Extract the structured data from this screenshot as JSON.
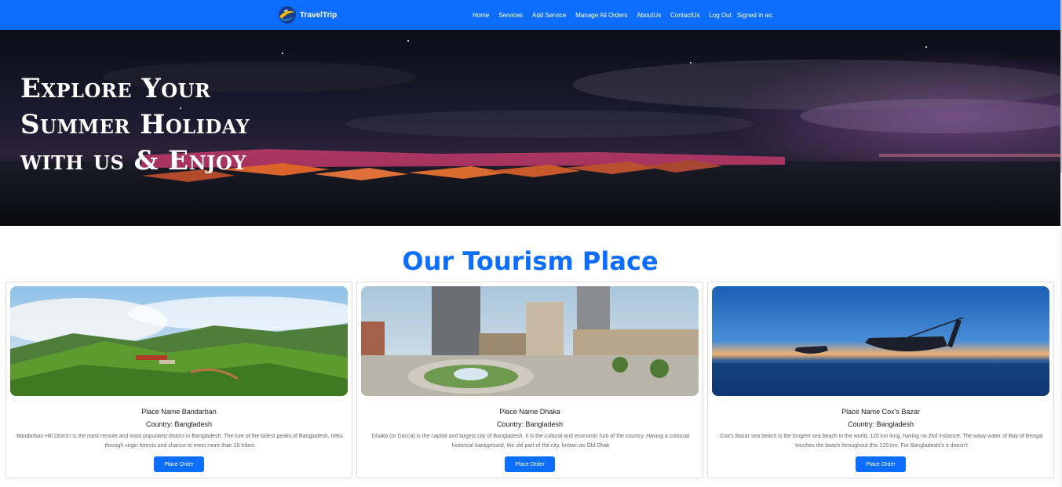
{
  "navbar": {
    "brand": "TravelTrip",
    "links": [
      "Home",
      "Services",
      "Add Service",
      "Manage All Orders",
      "AboutUs",
      "ContactUs",
      "Log Out"
    ],
    "signed_in": "Signed in as:"
  },
  "hero": {
    "lines": [
      "Explore Your",
      "Summer Holiday",
      "with us & Enjoy"
    ]
  },
  "section": {
    "title": "Our Tourism Place"
  },
  "cards": [
    {
      "name": "Place Name Bandarban",
      "country": "Country: Bangladesh",
      "description": "Bandarban Hill District is the most remote and least populated district in Bangladesh. The lure of the tallest peaks of Bangladesh, treks through virgin forests and chance to meet more than 15 tribes",
      "button": "Place Order"
    },
    {
      "name": "Place Name Dhaka",
      "country": "Country: Bangladesh",
      "description": "Dhaka (or Dacca) is the capital and largest city of Bangladesh. It is the cultural and economic hub of the country. Having a colossal historical background, the old part of the city, known as Old Dhak",
      "button": "Place Order"
    },
    {
      "name": "Place Name Cox's Bazar",
      "country": "Country: Bangladesh",
      "description": "Cox's Bazar sea beach is the longest sea beach in the world, 120 km long, having no 2nd instance. The wavy water of Bay of Bengal touches the beach throughout this 120 km. For Bangladeshi's it doesn't",
      "button": "Place Order"
    }
  ],
  "colors": {
    "primary": "#0d6efd",
    "text_dark": "#222222",
    "text_muted": "#666666"
  }
}
